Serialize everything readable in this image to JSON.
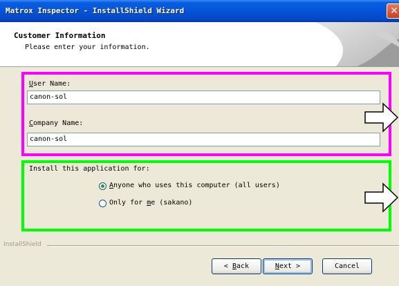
{
  "window": {
    "title": "Matrox Inspector - InstallShield Wizard",
    "close_glyph": "✕"
  },
  "header": {
    "title": "Customer Information",
    "subtitle": "Please enter your information."
  },
  "user_info": {
    "user_name_label_mnemonic": "U",
    "user_name_label_rest": "ser Name:",
    "user_name_value": "canon-sol",
    "company_label_mnemonic": "C",
    "company_label_rest": "ompany Name:",
    "company_value": "canon-sol"
  },
  "install_for": {
    "label": "Install this application for:",
    "option_all_mnemonic": "A",
    "option_all_rest": "nyone who uses this computer (all users)",
    "option_me_pre": "Only for ",
    "option_me_mnemonic": "m",
    "option_me_post": "e (sakano)",
    "selected": "all_users"
  },
  "footer": {
    "brand": "InstallShield"
  },
  "buttons": {
    "back_pre": "< ",
    "back_mnemonic": "B",
    "back_rest": "ack",
    "next_mnemonic": "N",
    "next_rest": "ext >",
    "cancel": "Cancel"
  },
  "annotations": {
    "user_box_color": "#FF00FF",
    "install_box_color": "#00FF00"
  }
}
